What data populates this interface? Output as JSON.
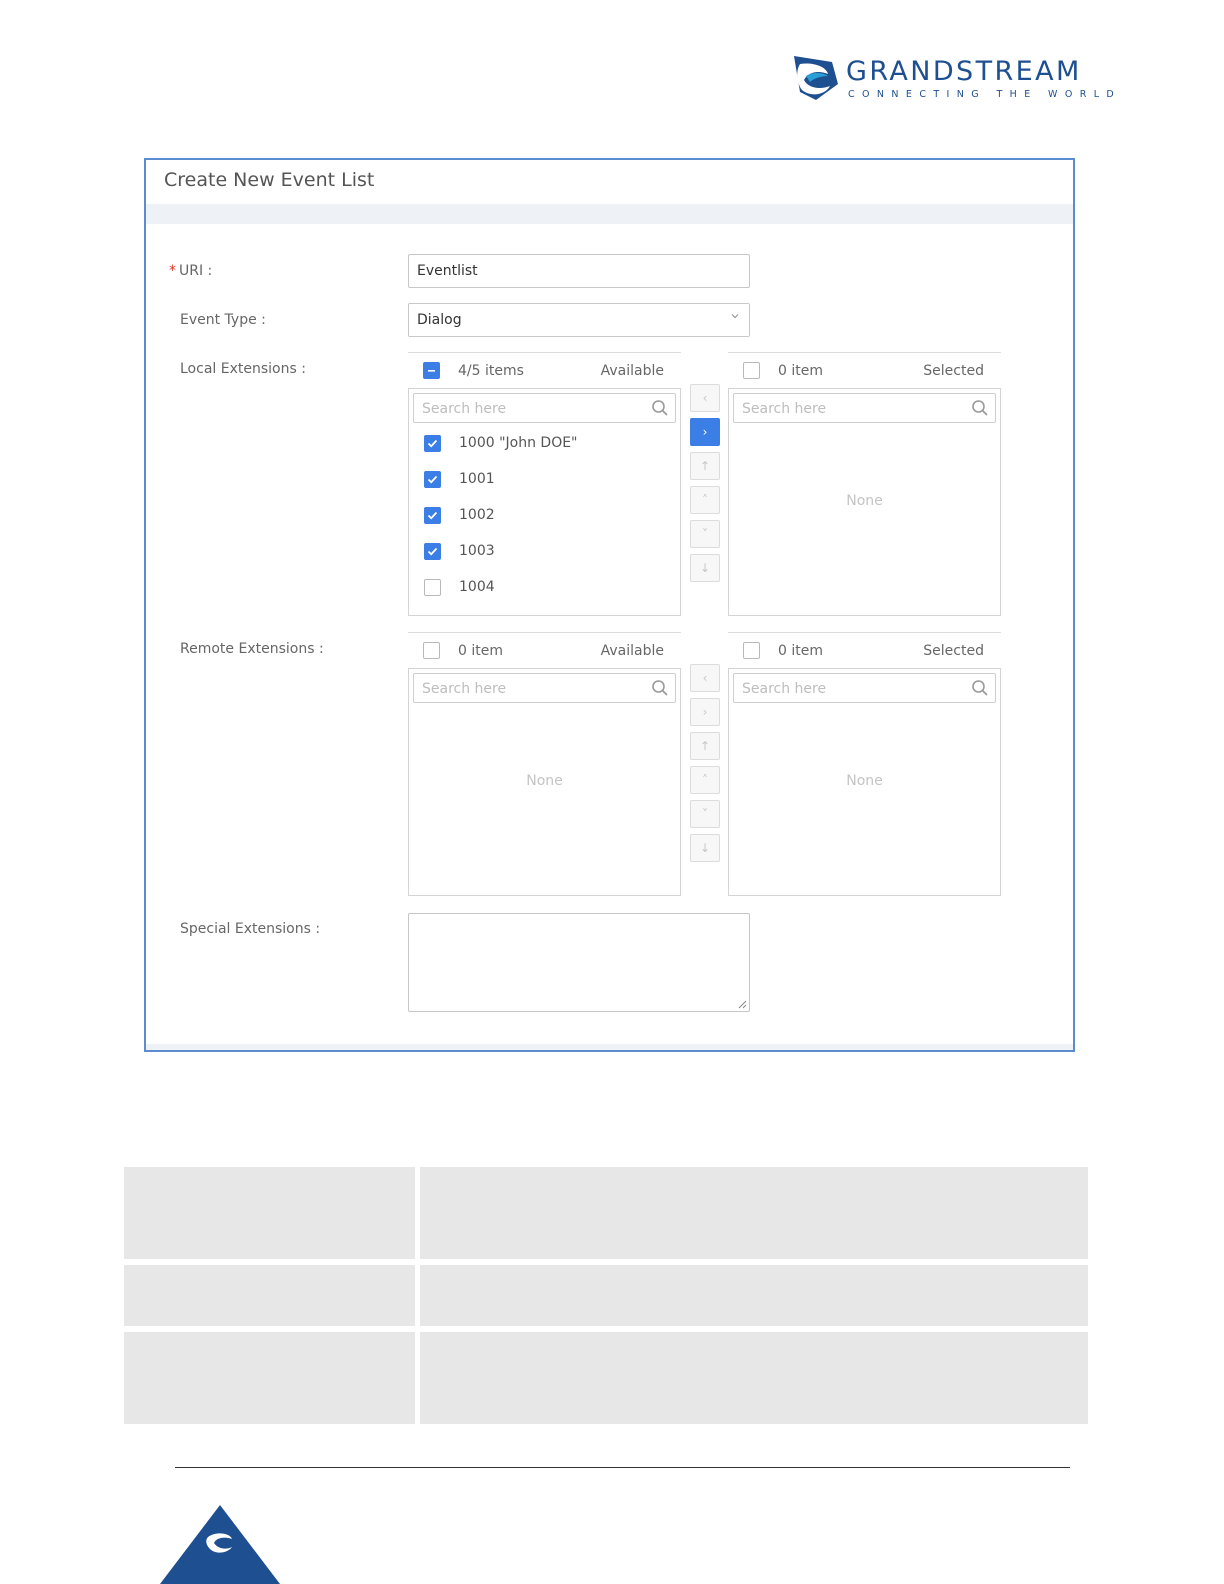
{
  "brand": {
    "name": "GRANDSTREAM",
    "tagline": "CONNECTING THE WORLD",
    "colors": {
      "primary": "#1d4f91",
      "accent": "#2a9fd6"
    }
  },
  "dialog": {
    "title": "Create New Event List",
    "uri": {
      "label": "URI :",
      "required_mark": "*",
      "value": "Eventlist"
    },
    "event_type": {
      "label": "Event Type :",
      "value": "Dialog"
    },
    "local_extensions": {
      "label": "Local Extensions :",
      "available": {
        "count": "4/5 items",
        "title": "Available",
        "search_placeholder": "Search here",
        "items": [
          {
            "label": "1000 \"John DOE\"",
            "checked": true
          },
          {
            "label": "1001",
            "checked": true
          },
          {
            "label": "1002",
            "checked": true
          },
          {
            "label": "1003",
            "checked": true
          },
          {
            "label": "1004",
            "checked": false
          }
        ]
      },
      "selected": {
        "count": "0 item",
        "title": "Selected",
        "search_placeholder": "Search here",
        "empty_text": "None"
      }
    },
    "remote_extensions": {
      "label": "Remote Extensions :",
      "available": {
        "count": "0 item",
        "title": "Available",
        "search_placeholder": "Search here",
        "empty_text": "None"
      },
      "selected": {
        "count": "0 item",
        "title": "Selected",
        "search_placeholder": "Search here",
        "empty_text": "None"
      }
    },
    "special_extensions": {
      "label": "Special Extensions :",
      "value": ""
    },
    "accent_color": "#3a7ee6"
  },
  "transfer_ops": [
    {
      "glyph": "‹",
      "name": "move-left"
    },
    {
      "glyph": "›",
      "name": "move-right"
    },
    {
      "glyph": "↑",
      "name": "move-top"
    },
    {
      "glyph": "˄",
      "name": "move-up"
    },
    {
      "glyph": "˅",
      "name": "move-down"
    },
    {
      "glyph": "↓",
      "name": "move-bottom"
    }
  ],
  "table_bg": "#e7e7e7"
}
